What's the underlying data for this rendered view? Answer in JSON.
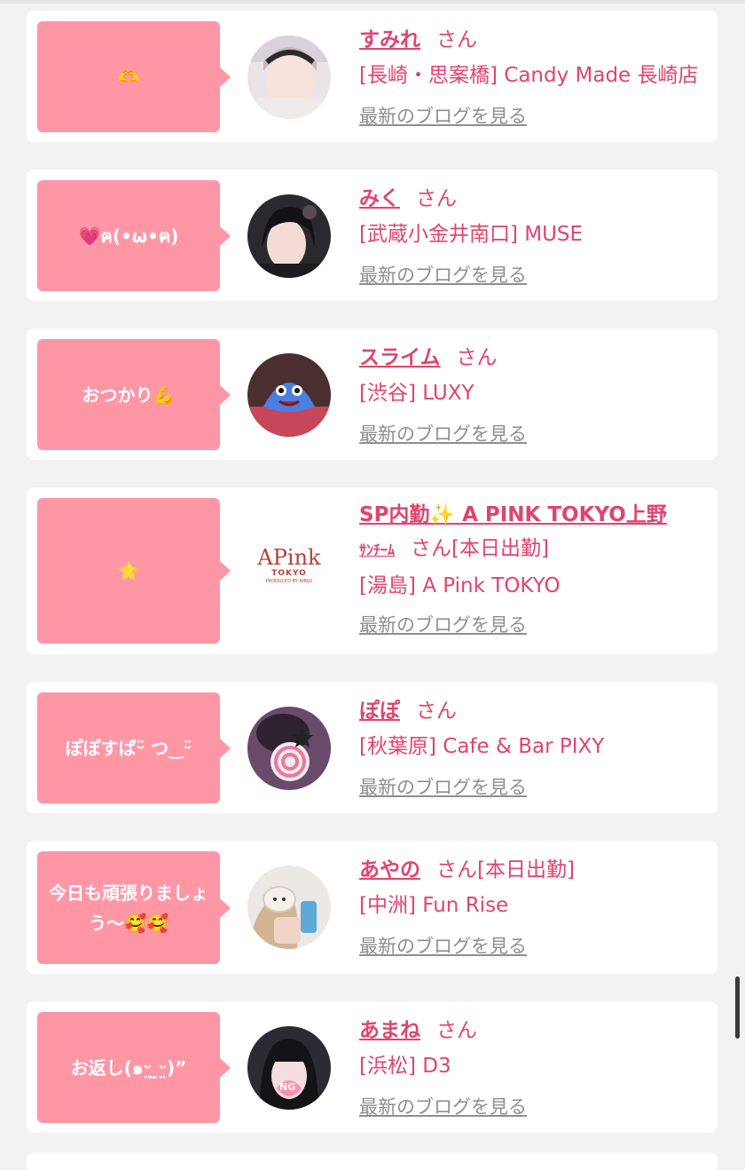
{
  "entries": [
    {
      "bubble": "🫶",
      "name": "すみれ",
      "suffix": "さん",
      "status": "",
      "store": "[長崎・思案橋] Candy Made 長崎店",
      "blog_link": "最新のブログを見る"
    },
    {
      "bubble": "💗ฅ(•ω•ฅ)",
      "name": "みく",
      "suffix": "さん",
      "status": "",
      "store": "[武蔵小金井南口] MUSE",
      "blog_link": "最新のブログを見る"
    },
    {
      "bubble": "おつかり💪",
      "name": "スライム",
      "suffix": "さん",
      "status": "",
      "store": "[渋谷] LUXY",
      "blog_link": "最新のブログを見る"
    },
    {
      "bubble": "⭐",
      "name": "SP内勤✨ A PINK TOKYO上野",
      "name2": "ｻﾝﾁｰﾑ",
      "suffix": "さん",
      "status": "[本日出勤]",
      "store": "[湯島] A Pink TOKYO",
      "blog_link": "最新のブログを見る",
      "logo": {
        "main": "APink",
        "sub": "TOKYO",
        "tag": "PRODUCED BY AIBIJU"
      }
    },
    {
      "bubble": "ぽぽすぱᵕ̈ つ‿ᵕ̈",
      "name": "ぽぽ",
      "suffix": "さん",
      "status": "",
      "store": "[秋葉原] Cafe & Bar PIXY",
      "blog_link": "最新のブログを見る"
    },
    {
      "bubble": "今日も頑張りましょう〜🥰🥰",
      "name": "あやの",
      "suffix": "さん",
      "status": "[本日出勤]",
      "store": "[中洲] Fun Rise",
      "blog_link": "最新のブログを見る"
    },
    {
      "bubble": "お返し(๑ᵕ̤ ̫ᵕ̤)”",
      "name": "あまね",
      "suffix": "さん",
      "status": "",
      "store": "[浜松] D3",
      "blog_link": "最新のブログを見る",
      "avatar_badge": "NG"
    }
  ],
  "colors": {
    "accent": "#e0446e",
    "bubble": "#ff96a6",
    "link_gray": "#8e8e8e",
    "background": "#f2f2f2"
  }
}
